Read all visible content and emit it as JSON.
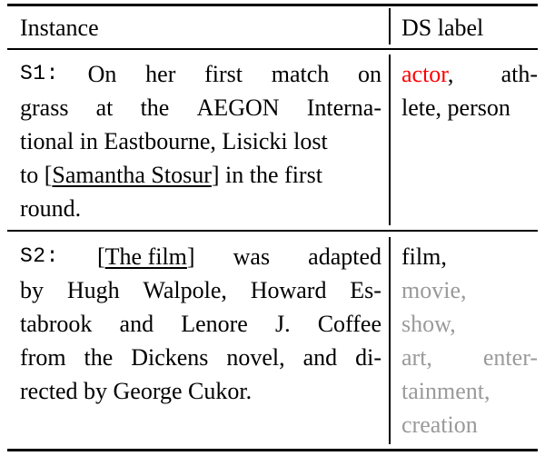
{
  "table": {
    "columns": [
      {
        "id": "instance",
        "header": "Instance"
      },
      {
        "id": "ds_label",
        "header": "DS label"
      }
    ],
    "colors": {
      "positive_label": "#ff0000",
      "distant_label": "#9a9a9a",
      "text": "#000000",
      "rule": "#000000",
      "background": "#ffffff"
    },
    "rows": [
      {
        "id": "S1",
        "sentence_id": "S1:",
        "instance_lines": [
          [
            "On",
            "her",
            "first",
            "match",
            "on"
          ],
          [
            "grass",
            "at",
            "the",
            "AEGON",
            "Interna-"
          ],
          [
            "tional in Eastbourne, Lisicki lost"
          ],
          [
            "to [",
            "Samantha Stosur",
            "] in the first"
          ],
          [
            "round."
          ]
        ],
        "entity_mention": "Samantha Stosur",
        "full_text": "S1: On her first match on grass at the AEGON International in Eastbourne, Lisicki lost to [Samantha Stosur] in the first round.",
        "ds_label_lines": [
          [
            {
              "text": "actor",
              "style": "red"
            },
            {
              "text": ",",
              "style": "black"
            },
            {
              "text": "ath-",
              "style": "black"
            }
          ],
          [
            {
              "text": "lete, person",
              "style": "black"
            }
          ]
        ],
        "ds_labels": [
          "actor",
          "athlete",
          "person"
        ],
        "ds_labels_highlighted": [
          "actor"
        ]
      },
      {
        "id": "S2",
        "sentence_id": "S2:",
        "instance_lines": [
          [
            "[",
            "The film",
            "]",
            "was",
            "adapted"
          ],
          [
            "by",
            "Hugh",
            "Walpole,",
            "Howard",
            "Es-"
          ],
          [
            "tabrook",
            "and",
            "Lenore",
            "J.",
            "Coffee"
          ],
          [
            "from",
            "the",
            "Dickens",
            "novel,",
            "and",
            "di-"
          ],
          [
            "rected by George Cukor."
          ]
        ],
        "entity_mention": "The film",
        "full_text": "S2: [The film] was adapted by Hugh Walpole, Howard Estabrook and Lenore J. Coffee from the Dickens novel, and directed by George Cukor.",
        "ds_label_lines": [
          [
            {
              "text": "film,",
              "style": "black"
            }
          ],
          [
            {
              "text": "movie,",
              "style": "gray"
            }
          ],
          [
            {
              "text": "show,",
              "style": "gray"
            }
          ],
          [
            {
              "text": "art,",
              "style": "gray"
            },
            {
              "text": "enter-",
              "style": "gray"
            }
          ],
          [
            {
              "text": "tainment,",
              "style": "gray"
            }
          ],
          [
            {
              "text": "creation",
              "style": "gray"
            }
          ]
        ],
        "ds_labels": [
          "film",
          "movie",
          "show",
          "art",
          "entertainment",
          "creation"
        ],
        "ds_labels_highlighted": []
      }
    ]
  }
}
